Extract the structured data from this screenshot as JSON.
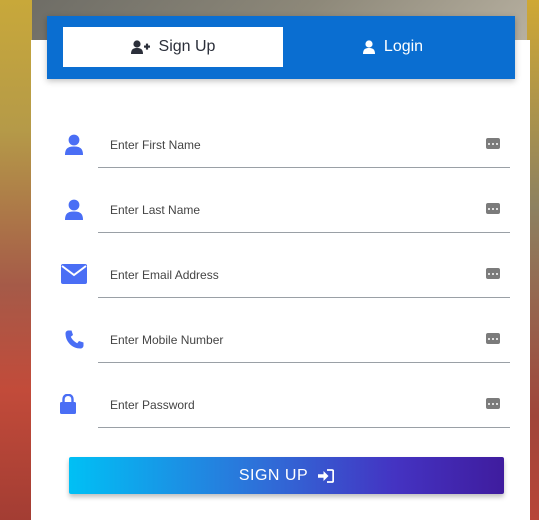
{
  "tabs": {
    "signup_label": "Sign Up",
    "login_label": "Login",
    "active": "signup"
  },
  "fields": [
    {
      "placeholder": "Enter First Name",
      "value": "",
      "icon": "user-icon"
    },
    {
      "placeholder": "Enter Last Name",
      "value": "",
      "icon": "user-icon"
    },
    {
      "placeholder": "Enter Email Address",
      "value": "",
      "icon": "envelope-icon"
    },
    {
      "placeholder": "Enter Mobile Number",
      "value": "",
      "icon": "phone-icon"
    },
    {
      "placeholder": "Enter Password",
      "value": "",
      "icon": "lock-icon"
    }
  ],
  "submit": {
    "label": "SIGN UP",
    "icon": "sign-in-icon"
  },
  "colors": {
    "primary": "#0a6ed1",
    "icon": "#4a6ef5",
    "button_gradient_start": "#00c0f5",
    "button_gradient_end": "#3f1c9e"
  }
}
